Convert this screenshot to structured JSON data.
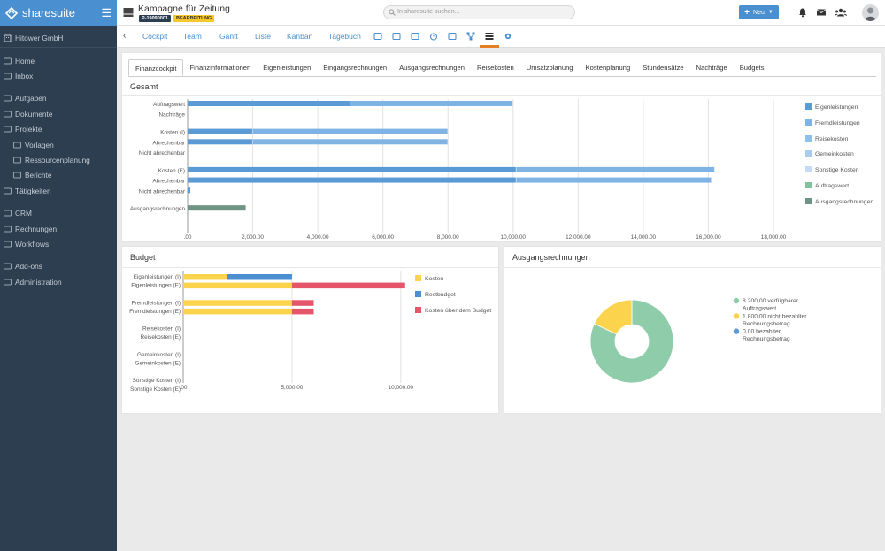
{
  "brand": {
    "name": "sharesuite"
  },
  "sidebar": {
    "company": "Hitower GmbH",
    "items": [
      {
        "label": "Home",
        "icon": "home-icon"
      },
      {
        "label": "Inbox",
        "icon": "inbox-icon"
      },
      {
        "label": "Aufgaben",
        "icon": "tasks-icon"
      },
      {
        "label": "Dokumente",
        "icon": "folder-icon"
      },
      {
        "label": "Projekte",
        "icon": "briefcase-icon"
      },
      {
        "label": "Vorlagen",
        "icon": "file-icon"
      },
      {
        "label": "Ressourcenplanung",
        "icon": "chart-icon"
      },
      {
        "label": "Berichte",
        "icon": "chart-icon"
      },
      {
        "label": "Tätigkeiten",
        "icon": "calendar-icon"
      },
      {
        "label": "CRM",
        "icon": "address-book-icon"
      },
      {
        "label": "Rechnungen",
        "icon": "invoice-icon"
      },
      {
        "label": "Workflows",
        "icon": "workflow-icon"
      },
      {
        "label": "Add-ons",
        "icon": "cloud-icon"
      },
      {
        "label": "Administration",
        "icon": "tools-icon"
      }
    ]
  },
  "header": {
    "title": "Kampagne für Zeitung",
    "project_id": "P-19090001",
    "status": "BEARBEITUNG",
    "search_placeholder": "In sharesuite suchen...",
    "new_button": "Neu"
  },
  "nav": {
    "tabs": [
      "Cockpit",
      "Team",
      "Gantt",
      "Liste",
      "Kanban",
      "Tagebuch"
    ],
    "icons": [
      "mail-icon",
      "list-icon",
      "folder-icon",
      "timer-icon",
      "document-icon",
      "workflow-icon",
      "finance-icon",
      "gear-icon"
    ]
  },
  "finance_tabs": [
    "Finanzcockpit",
    "Finanzinformationen",
    "Eigenleistungen",
    "Eingangsrechnungen",
    "Ausgangsrechnungen",
    "Reisekosten",
    "Umsatzplanung",
    "Kostenplanung",
    "Stundensätze",
    "Nachträge",
    "Budgets"
  ],
  "panels": {
    "gesamt": "Gesamt",
    "budget": "Budget",
    "ausgang": "Ausgangsrechnungen"
  },
  "colors": {
    "eigenleistungen": "#5b9bd5",
    "fremdleistungen": "#7fb3e3",
    "reisekosten": "#8fc0ea",
    "gemeinkosten": "#a8cdef",
    "sonstige": "#c4dcf3",
    "auftragswert": "#7fc29b",
    "ausgangsrechnungen": "#6f9483",
    "kosten": "#fcd34d",
    "restbudget": "#4a8fcf",
    "ueber_budget": "#e5566b",
    "pie_green": "#8fcdaa",
    "pie_yellow": "#fcd34d",
    "pie_blue": "#5b9bd5"
  },
  "chart_data": [
    {
      "type": "bar",
      "orientation": "horizontal",
      "title": "Gesamt",
      "categories": [
        "Auftragswert",
        "Nachträge",
        "Kosten (I)",
        "Abrechenbar",
        "Nicht abrechenbar",
        "Kosten (E)",
        "Abrechenbar",
        "Nicht abrechenbar",
        "Ausgangsrechnungen"
      ],
      "category_gaps_after": [
        1,
        4,
        7
      ],
      "series": [
        {
          "name": "Eigenleistungen",
          "values": [
            5000,
            0,
            2000,
            2000,
            0,
            10100,
            10100,
            100,
            0
          ]
        },
        {
          "name": "Fremdleistungen",
          "values": [
            5000,
            0,
            6000,
            6000,
            0,
            6100,
            6000,
            0,
            0
          ]
        },
        {
          "name": "Reisekosten",
          "values": [
            0,
            0,
            0,
            0,
            0,
            0,
            0,
            0,
            0
          ]
        },
        {
          "name": "Gemeinkosten",
          "values": [
            0,
            0,
            0,
            0,
            0,
            0,
            0,
            0,
            0
          ]
        },
        {
          "name": "Sonstige Kosten",
          "values": [
            0,
            0,
            0,
            0,
            0,
            0,
            0,
            0,
            0
          ]
        },
        {
          "name": "Auftragswert",
          "values": [
            0,
            0,
            0,
            0,
            0,
            0,
            0,
            0,
            0
          ]
        },
        {
          "name": "Ausgangsrechnungen",
          "values": [
            0,
            0,
            0,
            0,
            0,
            0,
            0,
            0,
            1800
          ]
        }
      ],
      "xlim": [
        0,
        18000
      ],
      "xticks": [
        0,
        2000,
        4000,
        6000,
        8000,
        10000,
        12000,
        14000,
        16000,
        18000
      ],
      "xtick_labels": [
        ".00",
        "2,000.00",
        "4,000.00",
        "6,000.00",
        "8,000.00",
        "10,000.00",
        "12,000.00",
        "14,000.00",
        "16,000.00",
        "18,000.00"
      ],
      "grid": true,
      "legend": "right"
    },
    {
      "type": "bar",
      "orientation": "horizontal",
      "stacked": true,
      "title": "Budget",
      "categories": [
        "Eigenleistungen (I)",
        "Eigenleistungen (E)",
        "Fremdleistungen (I)",
        "Fremdleistungen (E)",
        "Reisekosten (I)",
        "Reisekosten (E)",
        "Gemeinkosten (I)",
        "Gemeinkosten (E)",
        "Sonstige Kosten (I)",
        "Sonstige Kosten (E)"
      ],
      "series": [
        {
          "name": "Kosten",
          "values": [
            2000,
            5000,
            5000,
            5000,
            0,
            0,
            0,
            0,
            0,
            0
          ]
        },
        {
          "name": "Restbudget",
          "values": [
            3000,
            0,
            0,
            0,
            0,
            0,
            0,
            0,
            0,
            0
          ]
        },
        {
          "name": "Kosten über dem Budget",
          "values": [
            0,
            5200,
            1000,
            1000,
            0,
            0,
            0,
            0,
            0,
            0
          ]
        }
      ],
      "xlim": [
        0,
        12000
      ],
      "xticks": [
        0,
        5000,
        10000
      ],
      "xtick_labels": [
        ".00",
        "5,000.00",
        "10,000.00"
      ],
      "grid": true,
      "legend": "right"
    },
    {
      "type": "pie",
      "title": "Ausgangsrechnungen",
      "donut": true,
      "slices": [
        {
          "label": "8.200,00 verfügbarer Auftragswert",
          "value": 8200
        },
        {
          "label": "1.800,00 nicht bezahlter Rechnungsbetrag",
          "value": 1800
        },
        {
          "label": "0,00 bezahlter Rechnungsbetrag",
          "value": 0
        }
      ],
      "legend": "right"
    }
  ]
}
